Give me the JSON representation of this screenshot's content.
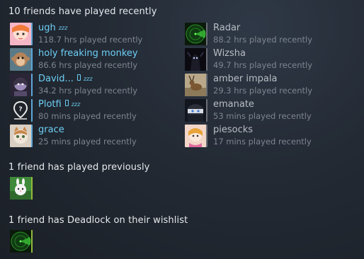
{
  "sections": {
    "recent_title": "10 friends have played recently",
    "previous_title": "1 friend has played previously",
    "wishlist_title": "1 friend has Deadlock on their wishlist"
  },
  "recent_left": [
    {
      "name": "ugh",
      "hours": "118.7 hrs played recently",
      "status": "online",
      "avatar": "anime-girl-avatar",
      "zz": "zzz",
      "phone": false
    },
    {
      "name": "holy freaking monkey",
      "hours": "86.6 hrs played recently",
      "status": "online",
      "avatar": "monkey-avatar",
      "zz": "",
      "phone": false
    },
    {
      "name": "David...",
      "hours": "34.2 hrs played recently",
      "status": "online",
      "avatar": "purple-face-avatar",
      "zz": "zzz",
      "phone": true
    },
    {
      "name": "Plotfi",
      "hours": "80 mins played recently",
      "status": "online",
      "avatar": "location-pin-avatar",
      "zz": "zzz",
      "phone": true
    },
    {
      "name": "grace",
      "hours": "25 mins played recently",
      "status": "online",
      "avatar": "cat-avatar",
      "zz": "",
      "phone": false
    }
  ],
  "recent_right": [
    {
      "name": "Radar",
      "hours": "88.2 hrs played recently",
      "status": "offline",
      "avatar": "radar-avatar"
    },
    {
      "name": "Wizsha",
      "hours": "49.7 hrs played recently",
      "status": "offline",
      "avatar": "dark-figure-avatar"
    },
    {
      "name": "amber impala",
      "hours": "29.3 hrs played recently",
      "status": "offline",
      "avatar": "impala-avatar"
    },
    {
      "name": "emanate",
      "hours": "53 mins played recently",
      "status": "offline",
      "avatar": "anime-dark-avatar"
    },
    {
      "name": "piesocks",
      "hours": "17 mins played recently",
      "status": "offline",
      "avatar": "pink-character-avatar"
    }
  ],
  "previous": [
    {
      "avatar": "white-bunny-avatar"
    }
  ],
  "wishlist": [
    {
      "avatar": "radar-avatar"
    }
  ],
  "colors": {
    "online": "#6dcff6",
    "offline_name": "#b9bec4",
    "ingame_border": "#90ba3c",
    "hours": "#7d8590"
  }
}
